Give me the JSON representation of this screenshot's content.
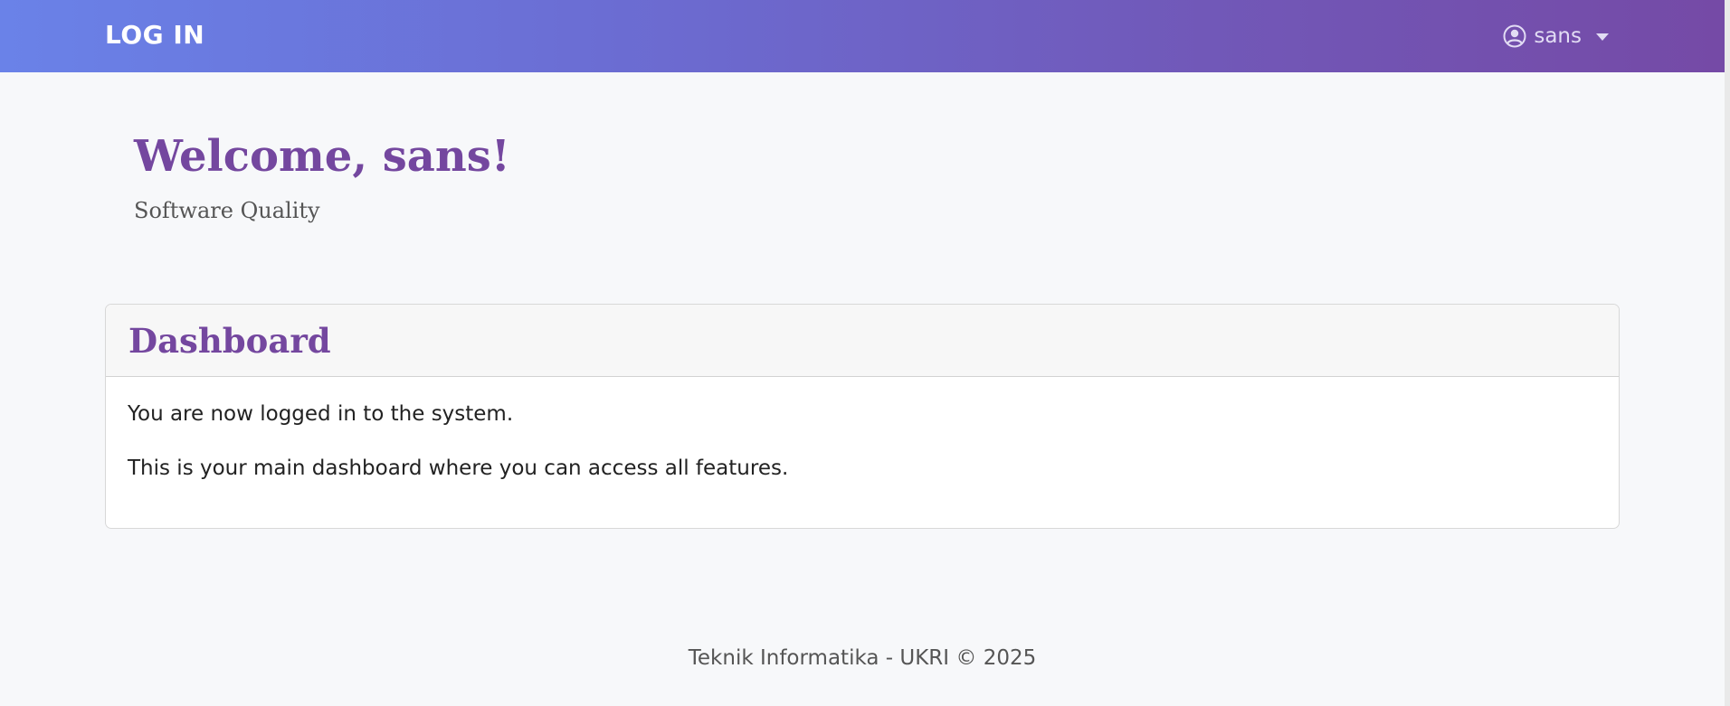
{
  "navbar": {
    "brand": "LOG IN",
    "user": {
      "icon": "user-circle-icon",
      "name": "sans"
    }
  },
  "hero": {
    "title": "Welcome, sans!",
    "subtitle": "Software Quality"
  },
  "card": {
    "title": "Dashboard",
    "line1": "You are now logged in to the system.",
    "line2": "This is your main dashboard where you can access all features."
  },
  "footer": {
    "text": "Teknik Informatika - UKRI © 2025"
  },
  "colors": {
    "accent": "#74479f",
    "gradient_start": "#6a82e8",
    "gradient_end": "#754aa6",
    "background": "#f7f8fa"
  }
}
